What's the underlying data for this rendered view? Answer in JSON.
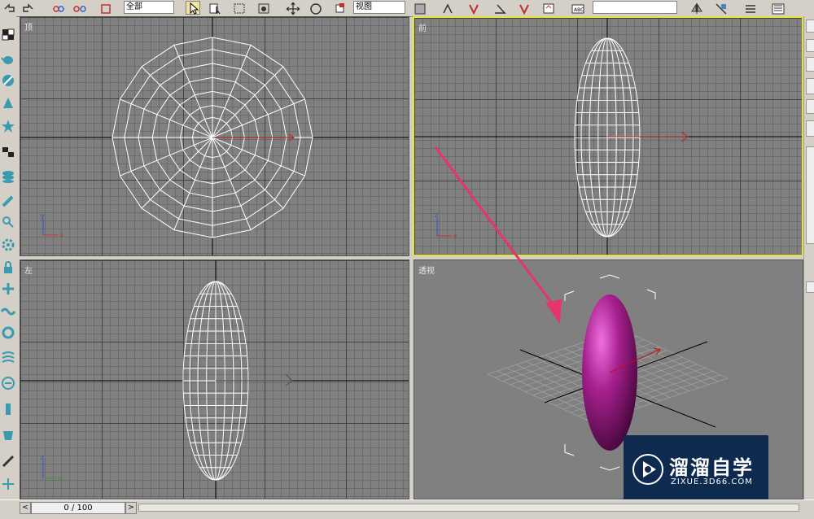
{
  "toolbar": {
    "selection_filter": "全部",
    "view_dropdown": "视图"
  },
  "viewports": {
    "top": {
      "label": "顶"
    },
    "front": {
      "label": "前"
    },
    "left": {
      "label": "左"
    },
    "perspective": {
      "label": "透视"
    }
  },
  "axis_tripod": {
    "x": "x",
    "y": "y",
    "z": "z"
  },
  "timeslider": {
    "value": "0 / 100",
    "left_arrow": "<",
    "right_arrow": ">"
  },
  "watermark": {
    "title": "溜溜自学",
    "url": "ZIXUE.3D66.COM"
  },
  "colors": {
    "viewport_bg": "#808080",
    "active_border": "#e6e23a",
    "wireframe": "#ffffff",
    "object_fill": "#8a1a7a",
    "annotation_arrow": "#e8336b",
    "ui_bg": "#d4d0c8"
  },
  "icons": {
    "toolbar": [
      "undo-icon",
      "redo-icon",
      "link-icon",
      "unlink-icon",
      "bind-icon",
      "select-icon",
      "select-by-name-icon",
      "rect-select-icon",
      "window-cross-icon",
      "move-icon",
      "rotate-icon",
      "scale-icon",
      "pivot-icon",
      "select-manipulate-icon",
      "snap-icon",
      "angle-snap-icon",
      "percent-snap-icon",
      "spinner-snap-icon",
      "edit-named-sel-icon",
      "mirror-icon",
      "align-icon",
      "layer-icon",
      "curve-editor-icon"
    ],
    "left": [
      "box-icon",
      "teapot-icon",
      "sphere-icon",
      "cone-icon",
      "star-icon",
      "plane-icon",
      "stack-icon",
      "pen-icon",
      "shape-icon",
      "gear-icon",
      "lock-icon",
      "tube-icon",
      "wave-icon",
      "ring-icon",
      "rope-icon",
      "bottle-icon",
      "flag-icon",
      "torus-icon"
    ]
  }
}
